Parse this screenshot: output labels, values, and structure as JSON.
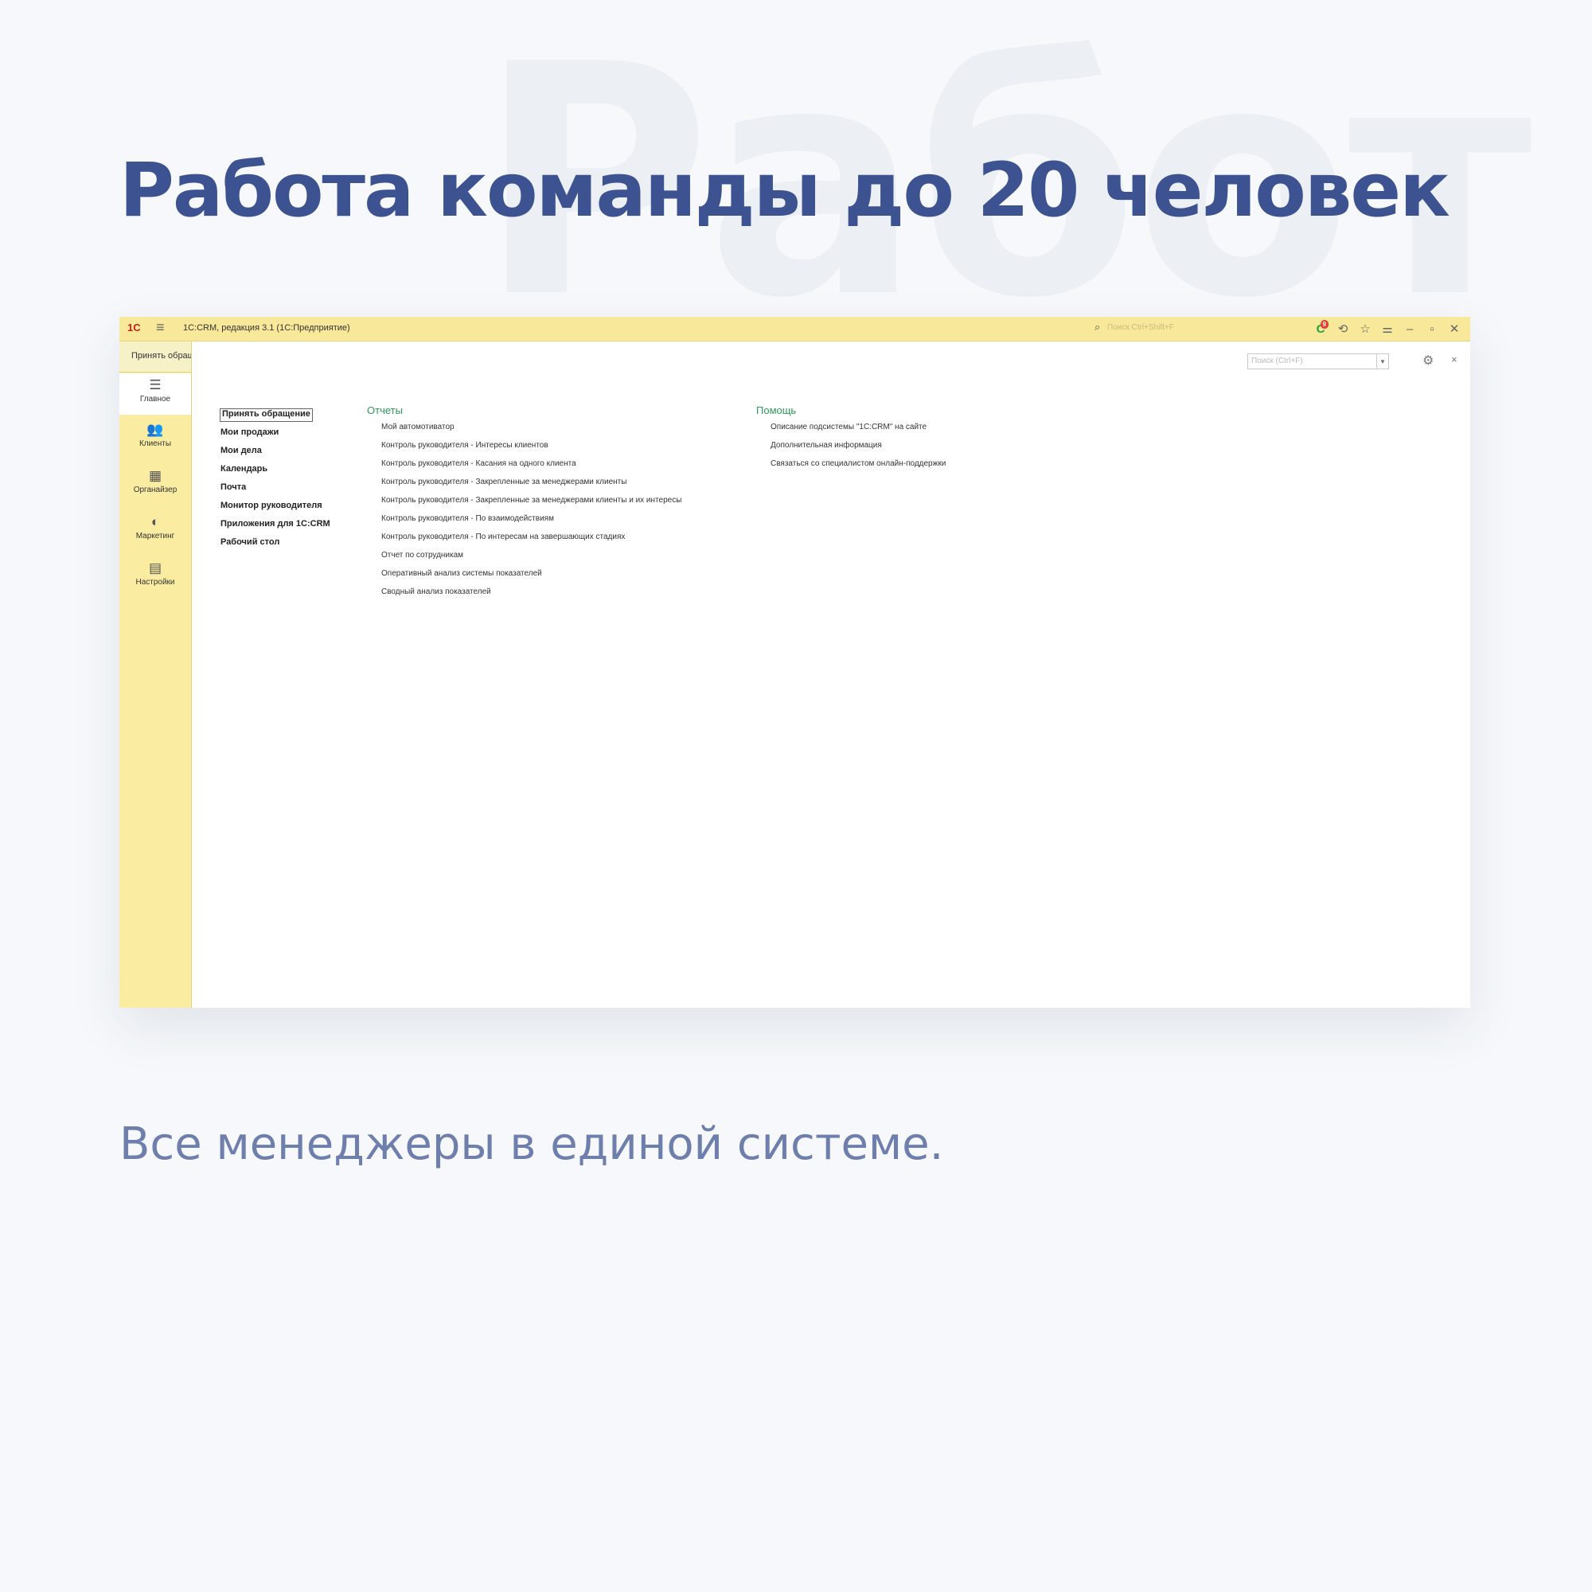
{
  "background_word": "Работ",
  "page_title": "Работа команды до 20 человек",
  "subtitle": "Все менеджеры в единой системе.",
  "window": {
    "logo": "1С",
    "app_title": "1С:CRM, редакция 3.1  (1С:Предприятие)",
    "titlebar_search_placeholder": "Поиск Ctrl+Shift+F",
    "notification_count": "9",
    "notification_icon": "C",
    "history_icon": "⟲",
    "star_icon": "☆",
    "filter_icon": "⚌",
    "minimize_icon": "–",
    "restore_icon": "▫",
    "close_icon": "✕"
  },
  "sidebar": {
    "accept_label": "Принять обращение",
    "items": [
      {
        "label": "Главное",
        "icon": "☰"
      },
      {
        "label": "Клиенты",
        "icon": "👥"
      },
      {
        "label": "Органайзер",
        "icon": "▦"
      },
      {
        "label": "Маркетинг",
        "icon": "◐"
      },
      {
        "label": "Настройки",
        "icon": "▤"
      }
    ]
  },
  "content": {
    "search_placeholder": "Поиск (Ctrl+F)",
    "dropdown_icon": "▾",
    "gear_icon": "⚙",
    "close_icon": "×",
    "nav": [
      "Принять обращение",
      "Мои продажи",
      "Мои дела",
      "Календарь",
      "Почта",
      "Монитор руководителя",
      "Приложения для 1С:CRM",
      "Рабочий стол"
    ],
    "reports_header": "Отчеты",
    "reports": [
      "Мой автомотиватор",
      "Контроль руководителя - Интересы клиентов",
      "Контроль руководителя - Касания на одного клиента",
      "Контроль руководителя - Закрепленные за менеджерами клиенты",
      "Контроль руководителя - Закрепленные за менеджерами клиенты и их интересы",
      "Контроль руководителя - По взаимодействиям",
      "Контроль руководителя - По интересам на завершающих стадиях",
      "Отчет по сотрудникам",
      "Оперативный анализ системы показателей",
      "Сводный анализ показателей"
    ],
    "help_header": "Помощь",
    "help": [
      "Описание подсистемы \"1С:CRM\" на сайте",
      "Дополнительная информация",
      "Связаться со специалистом онлайн-поддержки"
    ]
  }
}
